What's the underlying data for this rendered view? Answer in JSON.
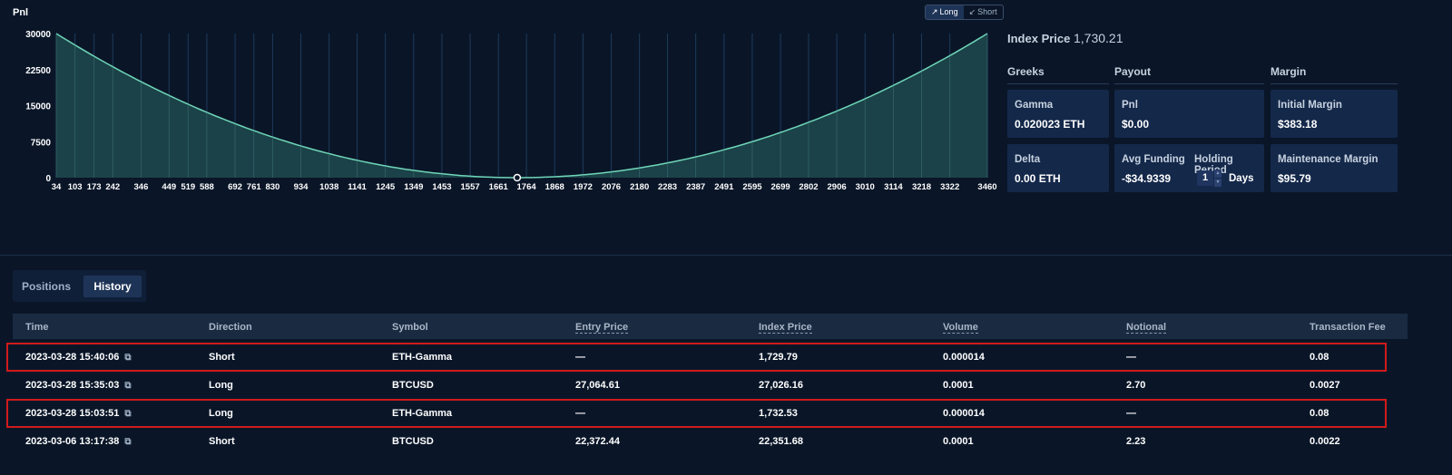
{
  "chart": {
    "title": "Pnl",
    "toggle": {
      "long_label": "Long",
      "short_label": "Short",
      "long_icon": "trend-up-icon",
      "short_icon": "trend-down-icon"
    }
  },
  "chart_data": {
    "type": "area",
    "title": "Pnl",
    "xlabel": "",
    "ylabel": "",
    "y_ticks": [
      "30000",
      "22500",
      "15000",
      "7500",
      "0"
    ],
    "ylim": [
      0,
      30000
    ],
    "x_ticks": [
      "34",
      "103",
      "173",
      "242",
      "346",
      "449",
      "519",
      "588",
      "692",
      "761",
      "830",
      "934",
      "1038",
      "1141",
      "1245",
      "1349",
      "1453",
      "1557",
      "1661",
      "1764",
      "1868",
      "1972",
      "2076",
      "2180",
      "2283",
      "2387",
      "2491",
      "2595",
      "2699",
      "2802",
      "2906",
      "3010",
      "3114",
      "3218",
      "3322",
      "3460"
    ],
    "xlim": [
      34,
      3460
    ],
    "series": [
      {
        "x": [
          34,
          346,
          692,
          1038,
          1245,
          1453,
          1661,
          1730,
          1868,
          2076,
          2283,
          2491,
          2802,
          3010,
          3218,
          3460
        ],
        "y": [
          30000,
          19800,
          10200,
          3930,
          1530,
          270,
          30,
          0,
          120,
          930,
          2840,
          5680,
          11300,
          16100,
          22000,
          30000
        ]
      }
    ],
    "marker": {
      "x": 1730,
      "y": 0
    },
    "grid": "vertical",
    "colors": {
      "line": "#6fd6b8",
      "fill": "#1f4a4d"
    }
  },
  "info": {
    "index_price_label": "Index Price",
    "index_price_value": "1,730.21",
    "greeks_header": "Greeks",
    "payout_header": "Payout",
    "margin_header": "Margin",
    "gamma_label": "Gamma",
    "gamma_value": "0.020023 ETH",
    "delta_label": "Delta",
    "delta_value": "0.00 ETH",
    "pnl_label": "Pnl",
    "pnl_value": "$0.00",
    "avg_funding_label": "Avg Funding",
    "avg_funding_value": "-$34.9339",
    "holding_period_label": "Holding Period",
    "holding_period_value": "1",
    "holding_period_unit": "Days",
    "initial_margin_label": "Initial Margin",
    "initial_margin_value": "$383.18",
    "maintenance_margin_label": "Maintenance Margin",
    "maintenance_margin_value": "$95.79"
  },
  "tabs": {
    "positions": "Positions",
    "history": "History",
    "active": "History"
  },
  "table": {
    "headers": [
      "Time",
      "Direction",
      "Symbol",
      "Entry Price",
      "Index Price",
      "Volume",
      "Notional",
      "Transaction Fee"
    ],
    "rows": [
      {
        "time": "2023-03-28 15:40:06",
        "direction": "Short",
        "symbol": "ETH-Gamma",
        "entry": "—",
        "index": "1,729.79",
        "volume": "0.000014",
        "notional": "—",
        "fee": "0.08",
        "highlighted": true
      },
      {
        "time": "2023-03-28 15:35:03",
        "direction": "Long",
        "symbol": "BTCUSD",
        "entry": "27,064.61",
        "index": "27,026.16",
        "volume": "0.0001",
        "notional": "2.70",
        "fee": "0.0027",
        "highlighted": false
      },
      {
        "time": "2023-03-28 15:03:51",
        "direction": "Long",
        "symbol": "ETH-Gamma",
        "entry": "—",
        "index": "1,732.53",
        "volume": "0.000014",
        "notional": "—",
        "fee": "0.08",
        "highlighted": true
      },
      {
        "time": "2023-03-06 13:17:38",
        "direction": "Short",
        "symbol": "BTCUSD",
        "entry": "22,372.44",
        "index": "22,351.68",
        "volume": "0.0001",
        "notional": "2.23",
        "fee": "0.0022",
        "highlighted": false
      }
    ],
    "link_icon": "external-link-icon",
    "highlight_color": "#d11a1a"
  }
}
